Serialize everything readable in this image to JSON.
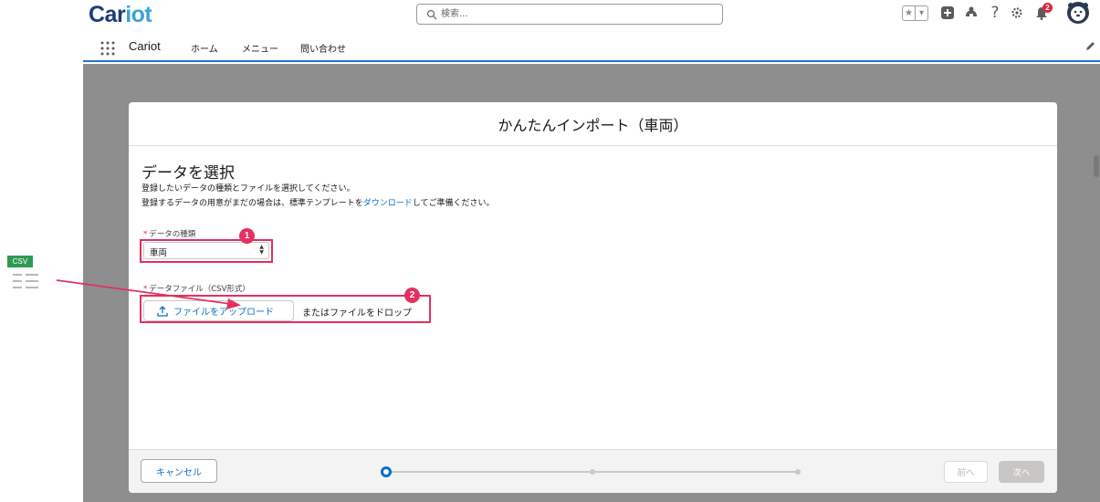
{
  "header": {
    "logo_part1": "Car",
    "logo_part2": "iot",
    "search_placeholder": "検索...",
    "help_label": "?",
    "notification_count": "2"
  },
  "nav": {
    "app_name": "Cariot",
    "items": [
      "ホーム",
      "メニュー",
      "問い合わせ"
    ]
  },
  "modal": {
    "title": "かんたんインポート（車両）",
    "heading": "データを選択",
    "desc1": "登録したいデータの種類とファイルを選択してください。",
    "desc2_before": "登録するデータの用意がまだの場合は、標準テンプレートを",
    "desc2_link": "ダウンロード",
    "desc2_after": "してご準備ください。",
    "data_type_label": "データの種類",
    "data_type_value": "車両",
    "file_label": "データファイル（CSV形式）",
    "upload_button": "ファイルをアップロード",
    "drop_text": "またはファイルをドロップ",
    "required_mark": "*",
    "callout_1": "1",
    "callout_2": "2"
  },
  "footer": {
    "cancel_button": "キャンセル",
    "prev_button": "前へ",
    "next_button": "次へ",
    "progress_steps": 3,
    "active_step": 1
  },
  "file_icon": {
    "label": "CSV"
  },
  "colors": {
    "brand_dark": "#1e3c7c",
    "brand_light": "#3aa2dc",
    "link": "#0b6ec9",
    "callout": "#e33060",
    "csv_green": "#2e9b54"
  }
}
